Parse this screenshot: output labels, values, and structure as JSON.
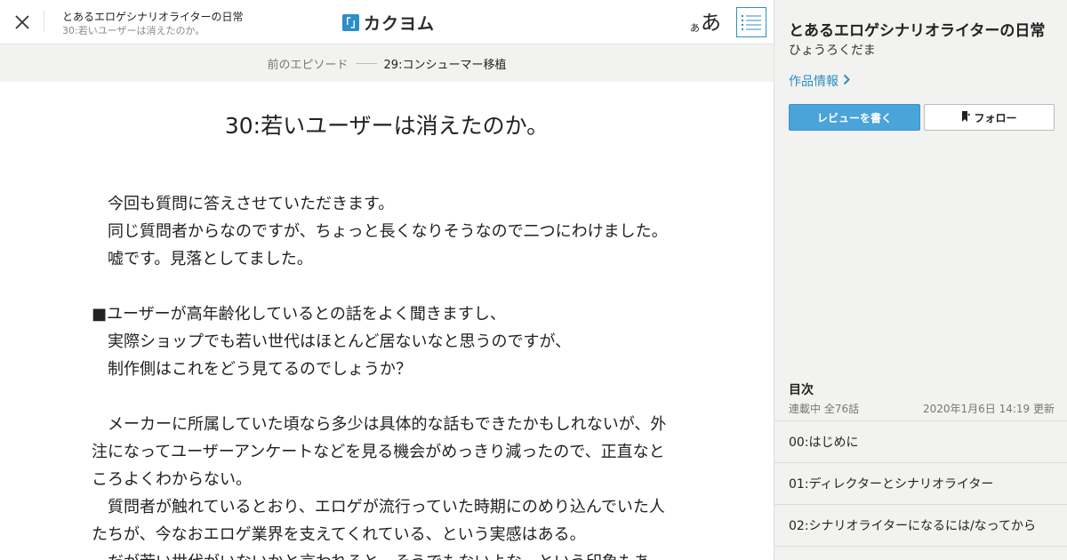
{
  "header": {
    "work_title": "とあるエロゲシナリオライターの日常",
    "episode_title": "30:若いユーザーは消えたのか。",
    "logo_mark": "「」",
    "logo_text": "カクヨム",
    "font_small": "あ",
    "font_large": "あ",
    "icons": {
      "close": "close-icon",
      "toc": "list-icon"
    }
  },
  "nav": {
    "prev_label": "前のエピソード",
    "prev_title": "29:コンシューマー移植"
  },
  "episode": {
    "title": "30:若いユーザーは消えたのか。",
    "lines": [
      "　今回も質問に答えさせていただきます。",
      "　同じ質問者からなのですが、ちょっと長くなりそうなので二つにわけました。",
      "　嘘です。見落としてました。",
      "",
      "■ユーザーが高年齢化しているとの話をよく聞きますし、",
      "　実際ショップでも若い世代はほとんど居ないなと思うのですが、",
      "　制作側はこれをどう見てるのでしょうか？",
      "",
      "　メーカーに所属していた頃なら多少は具体的な話もできたかもしれないが、外",
      "注になってユーザーアンケートなどを見る機会がめっきり減ったので、正直なと",
      "ころよくわからない。",
      "　質問者が触れているとおり、エロゲが流行っていた時期にのめり込んでいた人",
      "たちが、今なおエロゲ業界を支えてくれている、という実感はある。",
      "　だが若い世代がいないかと言われると、そうでもないよな、という印象もあ"
    ]
  },
  "sidebar": {
    "title": "とあるエロゲシナリオライターの日常",
    "author": "ひょうろくだま",
    "info_link": "作品情報",
    "review_button": "レビューを書く",
    "follow_button": "フォロー",
    "toc_heading": "目次",
    "toc_status": "連載中 全76話",
    "toc_updated": "2020年1月6日 14:19 更新",
    "toc_items": [
      "00:はじめに",
      "01:ディレクターとシナリオライター",
      "02:シナリオライターになるには/なってから"
    ],
    "colors": {
      "accent": "#2c8ec7",
      "button": "#4aa3d9",
      "background": "#f2f2f0"
    }
  }
}
